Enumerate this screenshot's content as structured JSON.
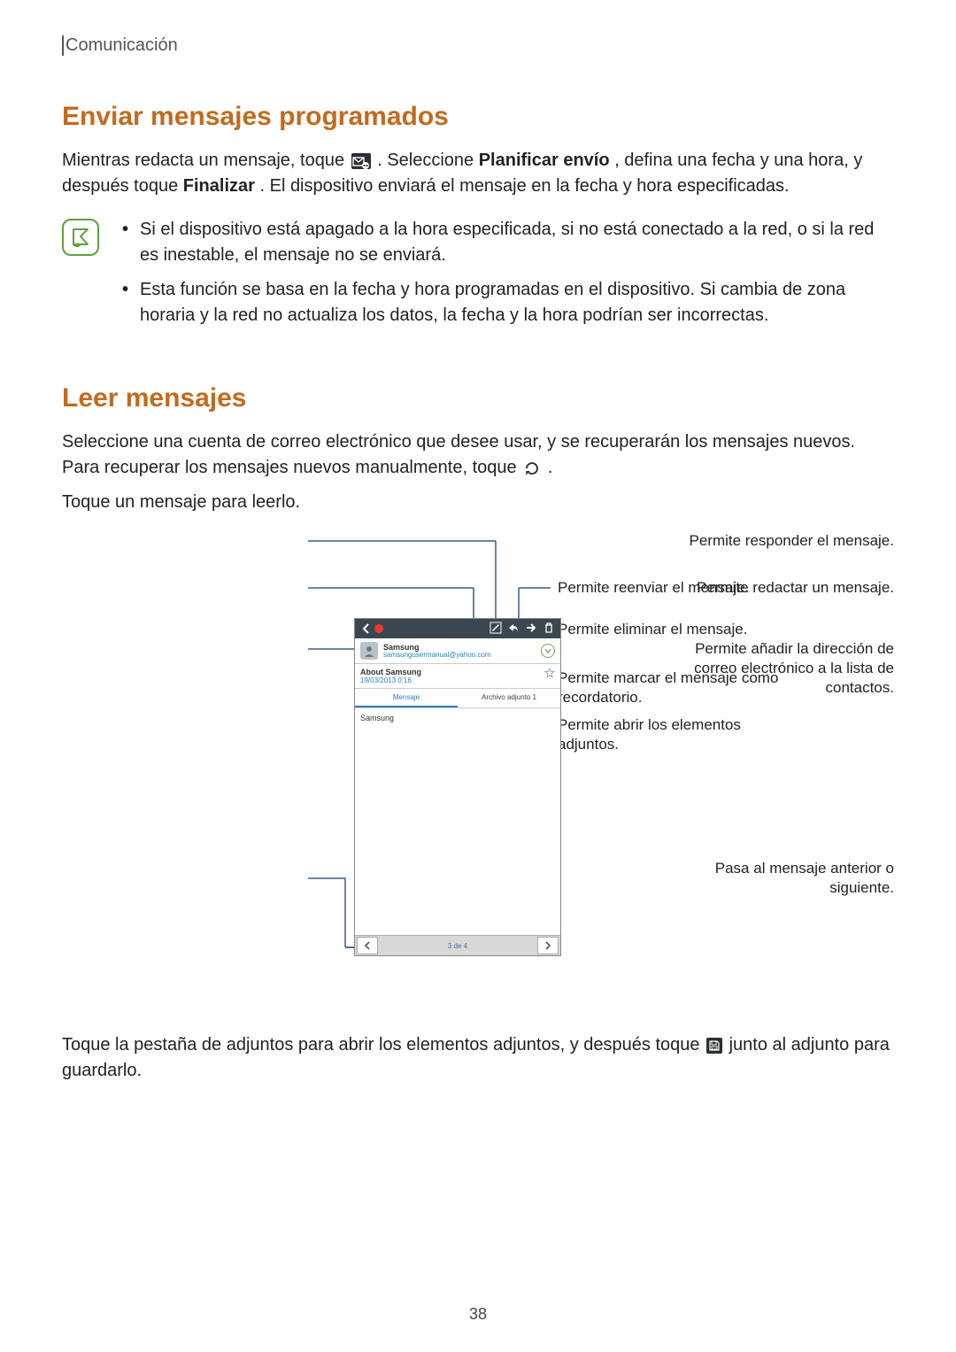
{
  "header": {
    "section": "Comunicación"
  },
  "h1": "Enviar mensajes programados",
  "p1a": "Mientras redacta un mensaje, toque ",
  "p1b": ". Seleccione ",
  "p1bold1": "Planificar envío",
  "p1c": ", defina una fecha y una hora, y después toque ",
  "p1bold2": "Finalizar",
  "p1d": ". El dispositivo enviará el mensaje en la fecha y hora especificadas.",
  "note1": "Si el dispositivo está apagado a la hora especificada, si no está conectado a la red, o si la red es inestable, el mensaje no se enviará.",
  "note2": "Esta función se basa en la fecha y hora programadas en el dispositivo. Si cambia de zona horaria y la red no actualiza los datos, la fecha y la hora podrían ser incorrectas.",
  "h2": "Leer mensajes",
  "p2a": "Seleccione una cuenta de correo electrónico que desee usar, y se recuperarán los mensajes nuevos. Para recuperar los mensajes nuevos manualmente, toque ",
  "p2b": ".",
  "p3": "Toque un mensaje para leerlo.",
  "labels": {
    "reply": "Permite responder el mensaje.",
    "compose": "Permite redactar un mensaje.",
    "addcontact": "Permite añadir la dirección de correo electrónico a la lista de contactos.",
    "prevnext": "Pasa al mensaje anterior o siguiente.",
    "forward": "Permite reenviar el mensaje.",
    "delete": "Permite eliminar el mensaje.",
    "reminder": "Permite marcar el mensaje como recordatorio.",
    "attachments": "Permite abrir los elementos adjuntos."
  },
  "phone": {
    "sender": "Samsung",
    "mail": "samsungusermanual@yahoo.com",
    "subject": "About Samsung",
    "date": "19/03/2013 0:16",
    "tab_msg": "Mensaje",
    "tab_att": "Archivo adjunto 1",
    "body": "Samsung",
    "counter": "3 de 4"
  },
  "p4a": "Toque la pestaña de adjuntos para abrir los elementos adjuntos, y después toque ",
  "p4b": " junto al adjunto para guardarlo.",
  "page_number": "38"
}
